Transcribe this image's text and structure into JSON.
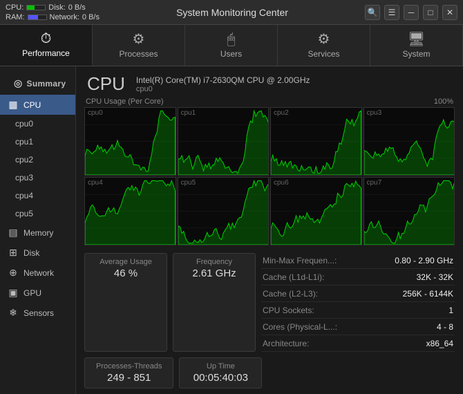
{
  "titlebar": {
    "cpu_label": "CPU:",
    "disk_label": "Disk:",
    "disk_value": "0 B/s",
    "ram_label": "RAM:",
    "network_label": "Network:",
    "network_value": "0 B/s",
    "title": "System Monitoring Center",
    "btn_search": "🔍",
    "btn_menu": "☰",
    "btn_minimize": "─",
    "btn_maximize": "□",
    "btn_close": "✕"
  },
  "nav": {
    "tabs": [
      {
        "id": "performance",
        "label": "Performance",
        "icon": "⏱",
        "active": true
      },
      {
        "id": "processes",
        "label": "Processes",
        "icon": "⚙",
        "active": false
      },
      {
        "id": "users",
        "label": "Users",
        "icon": "🖱",
        "active": false
      },
      {
        "id": "services",
        "label": "Services",
        "icon": "⚙",
        "active": false
      },
      {
        "id": "system",
        "label": "System",
        "icon": "🖥",
        "active": false
      }
    ]
  },
  "sidebar": {
    "sections": [
      {
        "label": "Summary",
        "items": []
      },
      {
        "label": "",
        "items": [
          {
            "id": "cpu",
            "label": "CPU",
            "icon": "💻",
            "active": true
          },
          {
            "id": "cpu0",
            "label": "cpu0",
            "icon": "",
            "active": false,
            "sub": true
          },
          {
            "id": "cpu1",
            "label": "cpu1",
            "icon": "",
            "active": false,
            "sub": true
          },
          {
            "id": "cpu2",
            "label": "cpu2",
            "icon": "",
            "active": false,
            "sub": true
          },
          {
            "id": "cpu3",
            "label": "cpu3",
            "icon": "",
            "active": false,
            "sub": true
          },
          {
            "id": "cpu4",
            "label": "cpu4",
            "icon": "",
            "active": false,
            "sub": true
          },
          {
            "id": "cpu5",
            "label": "cpu5",
            "icon": "",
            "active": false,
            "sub": true
          }
        ]
      },
      {
        "label": "Memory",
        "items": []
      },
      {
        "label": "Disk",
        "items": []
      },
      {
        "label": "Network",
        "items": []
      },
      {
        "label": "GPU",
        "items": []
      },
      {
        "label": "Sensors",
        "items": []
      }
    ]
  },
  "content": {
    "cpu_title": "CPU",
    "cpu_model": "Intel(R) Core(TM) i7-2630QM CPU @ 2.00GHz",
    "cpu_id": "cpu0",
    "graph_label": "CPU Usage (Per Core)",
    "graph_max": "100%",
    "graph_min": "0",
    "cores": [
      "cpu0",
      "cpu1",
      "cpu2",
      "cpu3",
      "cpu4",
      "cpu5",
      "cpu6",
      "cpu7"
    ],
    "stats": {
      "avg_label": "Average Usage",
      "avg_value": "46 %",
      "freq_label": "Frequency",
      "freq_value": "2.61 GHz",
      "proc_label": "Processes-Threads",
      "proc_value": "249 - 851",
      "uptime_label": "Up Time",
      "uptime_value": "00:05:40:03"
    },
    "info": [
      {
        "key": "Min-Max Frequen...:",
        "val": "0.80 - 2.90 GHz"
      },
      {
        "key": "Cache (L1d-L1i):",
        "val": "32K - 32K"
      },
      {
        "key": "Cache (L2-L3):",
        "val": "256K - 6144K"
      },
      {
        "key": "CPU Sockets:",
        "val": "1"
      },
      {
        "key": "Cores (Physical-L...:",
        "val": "4 - 8"
      },
      {
        "key": "Architecture:",
        "val": "x86_64"
      }
    ]
  }
}
